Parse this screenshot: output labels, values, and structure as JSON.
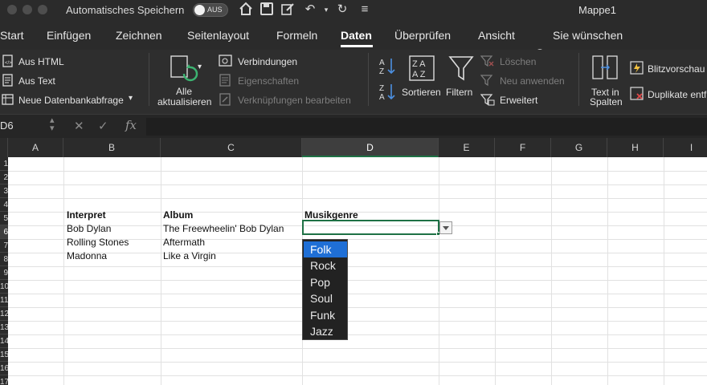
{
  "titlebar": {
    "autosave_label": "Automatisches Speichern",
    "autosave_state": "AUS",
    "window_title": "Mappe1"
  },
  "tabs": [
    {
      "label": "Start"
    },
    {
      "label": "Einfügen"
    },
    {
      "label": "Zeichnen"
    },
    {
      "label": "Seitenlayout"
    },
    {
      "label": "Formeln"
    },
    {
      "label": "Daten"
    },
    {
      "label": "Überprüfen"
    },
    {
      "label": "Ansicht"
    },
    {
      "label": "Sie wünschen"
    }
  ],
  "active_tab": "Daten",
  "ribbon": {
    "from_html": "Aus HTML",
    "from_text": "Aus Text",
    "new_db_query": "Neue Datenbankabfrage",
    "refresh_all_line1": "Alle",
    "refresh_all_line2": "aktualisieren",
    "connections": "Verbindungen",
    "properties": "Eigenschaften",
    "edit_links": "Verknüpfungen bearbeiten",
    "sort": "Sortieren",
    "filter": "Filtern",
    "clear": "Löschen",
    "reapply": "Neu anwenden",
    "advanced": "Erweitert",
    "text_to_columns_line1": "Text in",
    "text_to_columns_line2": "Spalten",
    "flash_fill": "Blitzvorschau",
    "remove_duplicates": "Duplikate entf"
  },
  "formula_bar": {
    "name_box": "D6",
    "fx": "fx",
    "content": ""
  },
  "columns": [
    "A",
    "B",
    "C",
    "D",
    "E",
    "F",
    "G",
    "H",
    "I"
  ],
  "row_labels": [
    "1",
    "2",
    "3",
    "4",
    "5",
    "6",
    "7",
    "8",
    "9",
    "10",
    "11",
    "12",
    "13",
    "14",
    "15",
    "16",
    "17"
  ],
  "cells": {
    "B5": "Interpret",
    "C5": "Album",
    "D5": "Musikgenre",
    "B6": "Bob Dylan",
    "C6": "The Freewheelin' Bob Dylan",
    "B7": "Rolling Stones",
    "C7": "Aftermath",
    "B8": "Madonna",
    "C8": "Like a Virgin"
  },
  "dropdown": {
    "options": [
      "Folk",
      "Rock",
      "Pop",
      "Soul",
      "Funk",
      "Jazz"
    ],
    "selected": "Folk"
  },
  "colors": {
    "accent_green": "#1e7145",
    "selection_blue": "#1f6fd6",
    "chrome_dark": "#2b2b2b"
  }
}
